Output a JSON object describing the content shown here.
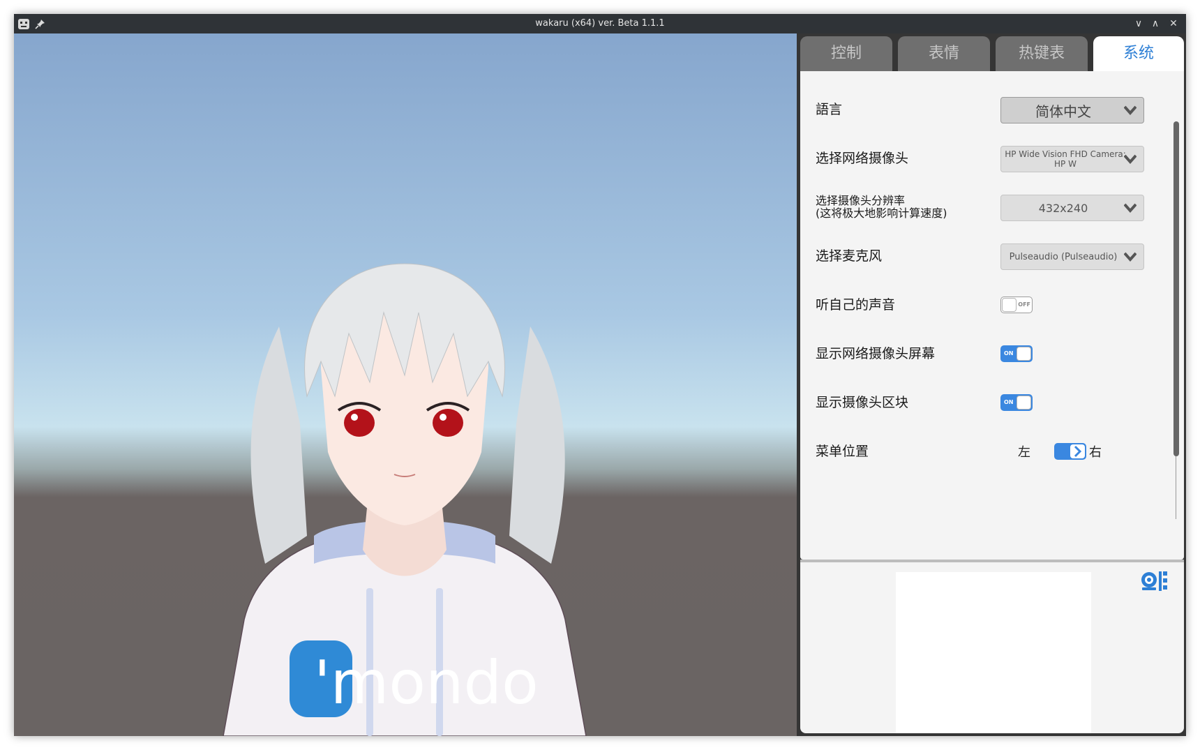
{
  "window": {
    "title": "wakaru (x64) ver. Beta 1.1.1",
    "controls": {
      "minimize": "∨",
      "maximize": "∧",
      "close": "✕"
    }
  },
  "tabs": [
    {
      "label": "控制",
      "active": false
    },
    {
      "label": "表情",
      "active": false
    },
    {
      "label": "热键表",
      "active": false
    },
    {
      "label": "系统",
      "active": true
    }
  ],
  "settings": {
    "language": {
      "label": "語言",
      "value": "简体中文"
    },
    "webcam": {
      "label": "选择网络摄像头",
      "value": "HP Wide Vision FHD Camera: HP W"
    },
    "resolution": {
      "label": "选择摄像头分辨率\n(这将极大地影响计算速度)",
      "value": "432x240"
    },
    "microphone": {
      "label": "选择麦克风",
      "value": "Pulseaudio (Pulseaudio)"
    },
    "monitor_audio": {
      "label": "听自己的声音",
      "state": "OFF"
    },
    "show_webcam": {
      "label": "显示网络摄像头屏幕",
      "state": "ON"
    },
    "show_camera_block": {
      "label": "显示摄像头区块",
      "state": "ON"
    },
    "menu_position": {
      "label": "菜单位置",
      "left": "左",
      "right": "右",
      "selected": "右"
    }
  },
  "viewport": {
    "hoodie_text": "'mondo"
  },
  "colors": {
    "accent": "#3a87e0",
    "tab_active_text": "#2d7fd5",
    "tab_inactive": "#6f6f6f",
    "titlebar": "#2f3337"
  },
  "icons": {
    "app": "app-icon",
    "pin": "pin-icon",
    "dropdown": "chevron-down-icon",
    "camera_toggle": "webcam-icon"
  }
}
